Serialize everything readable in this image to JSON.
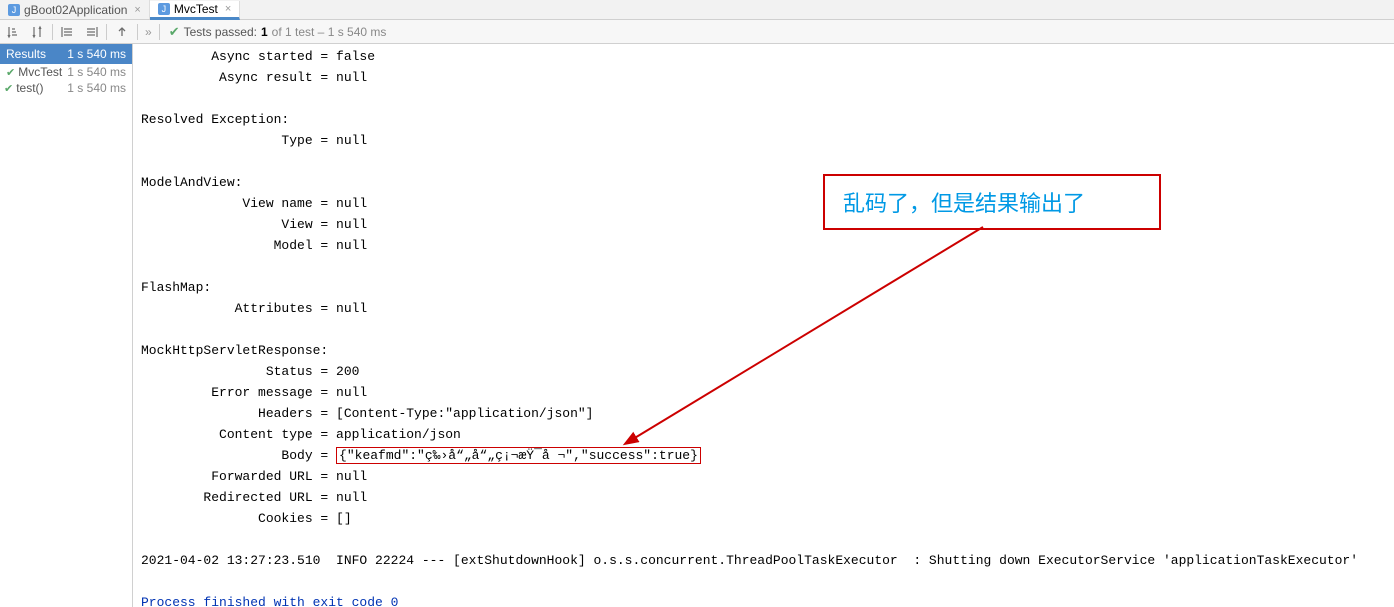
{
  "tabs": [
    {
      "label": "gBoot02Application",
      "icon": "J"
    },
    {
      "label": "MvcTest",
      "icon": "J",
      "active": true
    }
  ],
  "toolbar": {
    "test_status_prefix": "Tests passed:",
    "test_count": "1",
    "test_status_suffix": "of 1 test – 1 s 540 ms",
    "chevron": "»"
  },
  "side": {
    "header_label": "Results",
    "header_time": "1 s 540 ms",
    "rows": [
      {
        "label": "MvcTest",
        "time": "1 s 540 ms",
        "indent": 1
      },
      {
        "label": "test()",
        "time": "1 s 540 ms",
        "indent": 2
      }
    ]
  },
  "console": {
    "lines": [
      "         Async started = false",
      "          Async result = null",
      "",
      "Resolved Exception:",
      "                  Type = null",
      "",
      "ModelAndView:",
      "             View name = null",
      "                  View = null",
      "                 Model = null",
      "",
      "FlashMap:",
      "            Attributes = null",
      "",
      "MockHttpServletResponse:",
      "                Status = 200",
      "         Error message = null",
      "               Headers = [Content-Type:\"application/json\"]",
      "          Content type = application/json"
    ],
    "body_prefix": "                  Body = ",
    "body_value": "{\"keafmd\":\"ç‰›å“„å“„ç¡¬æŸ¯å ¬\",\"success\":true}",
    "lines_after": [
      "         Forwarded URL = null",
      "        Redirected URL = null",
      "               Cookies = []",
      "",
      "2021-04-02 13:27:23.510  INFO 22224 --- [extShutdownHook] o.s.s.concurrent.ThreadPoolTaskExecutor  : Shutting down ExecutorService 'applicationTaskExecutor'",
      ""
    ],
    "exit_line": "Process finished with exit code 0"
  },
  "annotation": {
    "text": "乱码了，但是结果输出了"
  },
  "icons": {
    "sort1": "↓₂",
    "sort2": "⇵",
    "expand": "≡",
    "collapse": "≣",
    "back": "↶"
  }
}
